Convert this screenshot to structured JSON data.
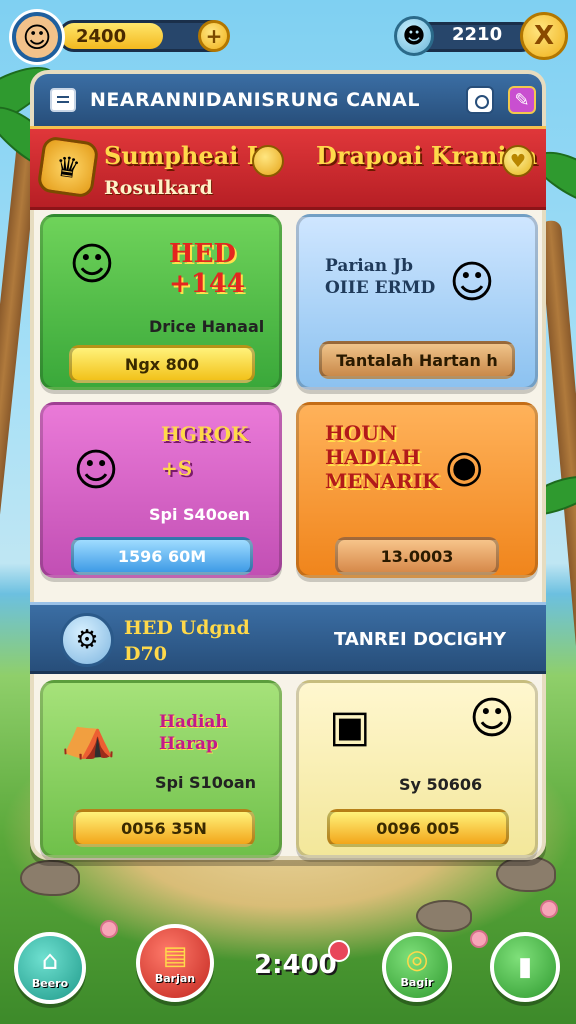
{
  "topbar": {
    "coins": "2400",
    "plus_label": "+",
    "score": "2210",
    "close_label": "X"
  },
  "panel": {
    "title": "NEARANNIDANISRUNG CANAL",
    "banner": {
      "left_title": "Sumpheai L",
      "left_sub": "Rosulkard",
      "right_title": "Drapoai Kraniea"
    },
    "cards": [
      {
        "big": "HED +144",
        "line": "Drice Hanaal",
        "button": "Ngx 800",
        "color": "#3aa83a"
      },
      {
        "big": "Parian Jb\nOIIE ERMD",
        "line": "",
        "button": "Tantalah Hartan h",
        "color": "#8cc2f0"
      },
      {
        "big": "HGROK +S",
        "line": "Spi S40oen",
        "button": "1596 60M",
        "color": "#c24fb4"
      },
      {
        "big": "HOUN HADIAH MENARIK",
        "line": "",
        "button": "13.0003",
        "color": "#f0851c"
      }
    ],
    "mid_banner": {
      "left_title": "HED Udgnd",
      "left_sub": "D70",
      "right_title": "TANREI DOCIGHY"
    },
    "cards2": [
      {
        "big": "Hadiah Harap",
        "line": "Spi S10oan",
        "button": "0056 35N"
      },
      {
        "big": "",
        "line": "Sy 50606",
        "button": "0096 005"
      }
    ]
  },
  "bottom_nav": {
    "home_label": "Beero",
    "shop_label": "Barjan",
    "value": "2:400",
    "coins_label": "Bagir"
  }
}
